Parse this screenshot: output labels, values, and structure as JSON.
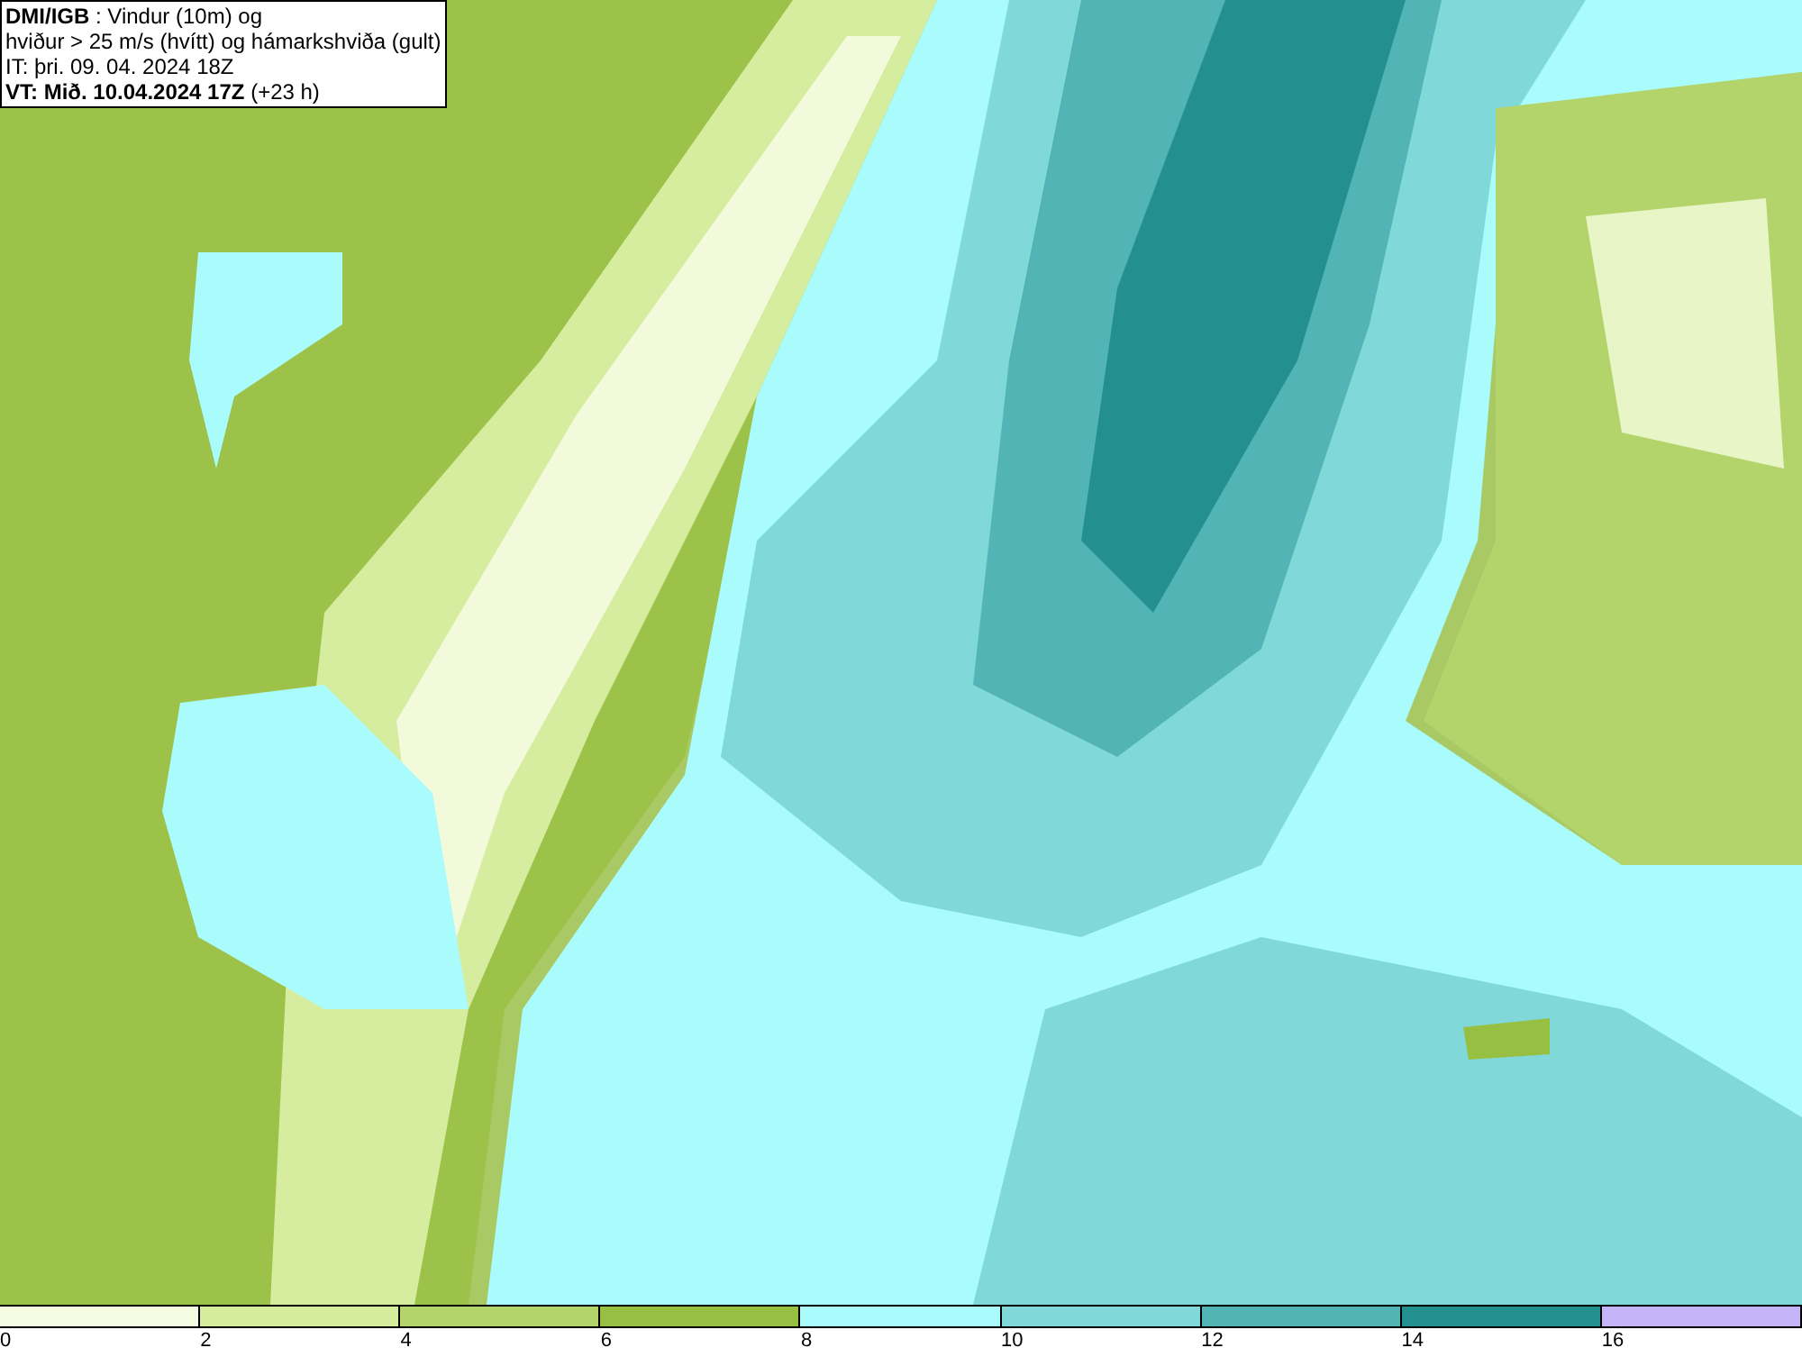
{
  "title_box": {
    "lines": [
      "**DMI/IGB** : Vindur (10m) og",
      "hviður > 25 m/s (hvítt) og hámarkshviða (gult)",
      "IT: þri. 09. 04. 2024 18Z",
      "**VT: Mið. 10.04.2024 17Z** (+23 h)"
    ]
  },
  "legend": [
    {
      "label": "0",
      "color": "#f5fbe0"
    },
    {
      "label": "2",
      "color": "#d4ec9c"
    },
    {
      "label": "4",
      "color": "#b3d46a"
    },
    {
      "label": "6",
      "color": "#97c043"
    },
    {
      "label": "8",
      "color": "#aafcfc"
    },
    {
      "label": "10",
      "color": "#80d8d8"
    },
    {
      "label": "12",
      "color": "#52b4b4"
    },
    {
      "label": "14",
      "color": "#23908f"
    },
    {
      "label": "16",
      "color": "#c5b3f7"
    }
  ]
}
